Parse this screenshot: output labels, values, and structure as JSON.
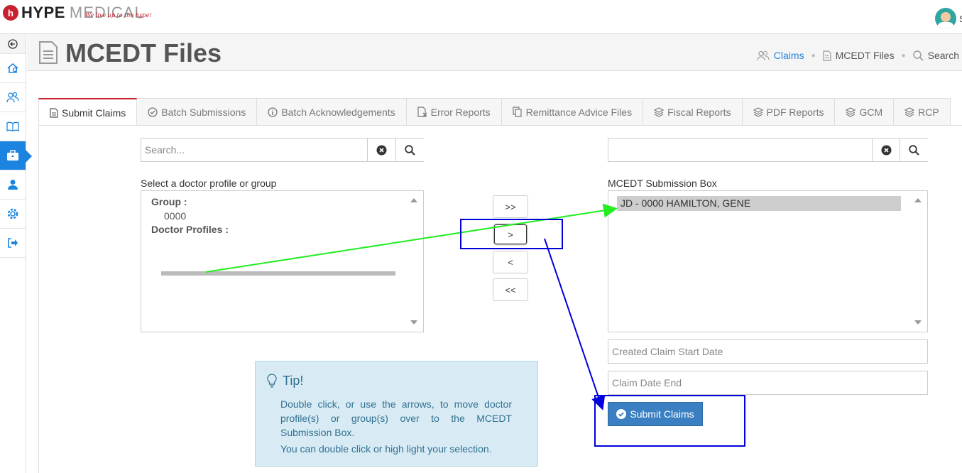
{
  "brand": {
    "badge": "h",
    "name_bold": "HYPE",
    "name_light": "MEDICAL",
    "tagline": "We live up to the hype!"
  },
  "user": {
    "initial": "S"
  },
  "page": {
    "title": "MCEDT Files"
  },
  "breadcrumb": {
    "item1": "Claims",
    "item2": "MCEDT Files",
    "item3": "Search"
  },
  "tabs": [
    {
      "label": "Submit Claims"
    },
    {
      "label": "Batch Submissions"
    },
    {
      "label": "Batch Acknowledgements"
    },
    {
      "label": "Error Reports"
    },
    {
      "label": "Remittance Advice Files"
    },
    {
      "label": "Fiscal Reports"
    },
    {
      "label": "PDF Reports"
    },
    {
      "label": "GCM"
    },
    {
      "label": "RCP"
    }
  ],
  "left": {
    "search_placeholder": "Search...",
    "label": "Select a doctor profile or group",
    "group_heading": "Group :",
    "group_value": "0000",
    "doctor_heading": "Doctor Profiles :"
  },
  "arrows": {
    "all_right": ">>",
    "right": ">",
    "left": "<",
    "all_left": "<<"
  },
  "right": {
    "search_placeholder": "",
    "label": "MCEDT Submission Box",
    "selected_item": "JD - 0000 HAMILTON, GENE",
    "start_date_placeholder": "Created Claim Start Date",
    "end_date_placeholder": "Claim Date End",
    "submit_label": "Submit Claims"
  },
  "tip": {
    "title": "Tip!",
    "text1": "Double click, or use the arrows, to move doctor profile(s) or group(s) over to the MCEDT Submission Box.",
    "text2": "You can double click or high light your selection."
  },
  "colors": {
    "brand_red": "#c8202f",
    "accent_blue": "#1b84e0",
    "annotation_green": "#22ee22",
    "annotation_blue": "#0000dd"
  }
}
